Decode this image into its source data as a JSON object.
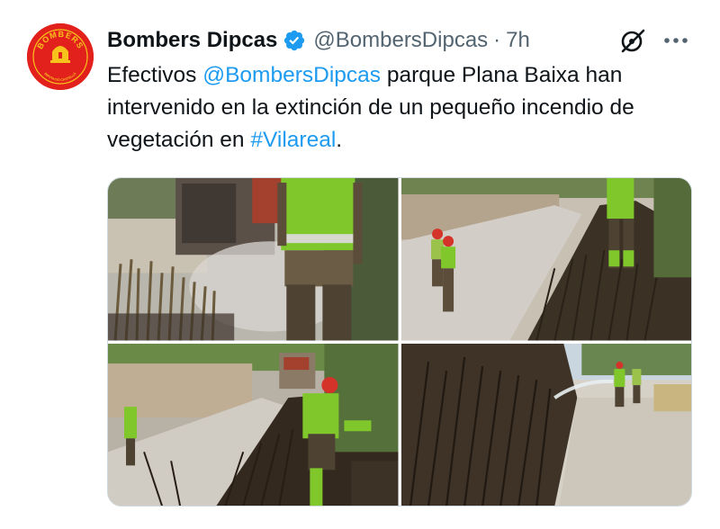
{
  "author": {
    "display_name": "Bombers Dipcas",
    "handle": "@BombersDipcas",
    "separator": "·",
    "time": "7h",
    "verified": true,
    "avatar": {
      "top_text": "BOMBERS",
      "bottom_text": "DIPUTACIÓ CASTELLÓ",
      "bg_color": "#e2211c",
      "ring_color": "#f7c21b"
    }
  },
  "icons": {
    "verified": "verified-badge-icon",
    "grok": "grok-icon",
    "more": "more-options-icon"
  },
  "tweet": {
    "part1": "Efectivos ",
    "mention": "@BombersDipcas",
    "part2": " parque Plana Baixa han intervenido en la extinción de un pequeño incendio de vegetación en ",
    "hashtag": "#Vilareal",
    "part3": "."
  },
  "media": [
    {
      "description": "firefighter-spraying-burning-cane"
    },
    {
      "description": "firefighters-on-path-by-burnt-vegetation"
    },
    {
      "description": "firefighter-hose-near-truck"
    },
    {
      "description": "firefighters-spraying-water-on-road"
    }
  ],
  "colors": {
    "link": "#1d9bf0",
    "secondary": "#536471",
    "text": "#0f1419",
    "verified": "#1d9bf0",
    "border": "#cfd9de"
  }
}
